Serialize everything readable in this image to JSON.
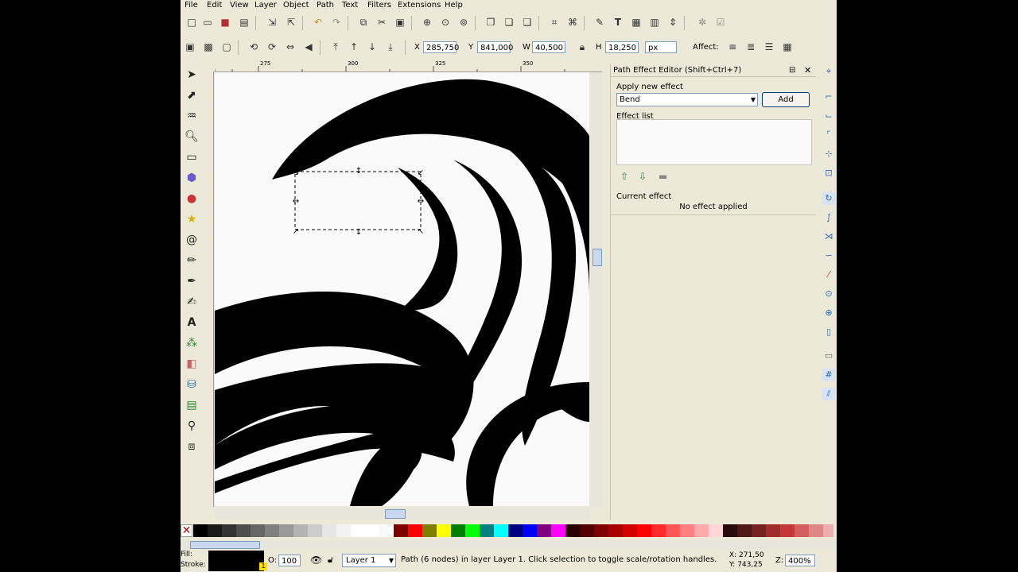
{
  "menu": [
    "File",
    "Edit",
    "View",
    "Layer",
    "Object",
    "Path",
    "Text",
    "Filters",
    "Extensions",
    "Help"
  ],
  "toolcontrols": {
    "x_label": "X",
    "x_value": "285,750",
    "y_label": "Y",
    "y_value": "841,000",
    "w_label": "W",
    "w_value": "40,500",
    "h_label": "H",
    "h_value": "18,250",
    "unit": "px",
    "affect_label": "Affect:"
  },
  "ruler": {
    "top": [
      "275",
      "300",
      "325",
      "350",
      "375"
    ]
  },
  "dock": {
    "title": "Path Effect Editor (Shift+Ctrl+7)",
    "apply_label": "Apply new effect",
    "effect_selected": "Bend",
    "add_label": "Add",
    "list_label": "Effect list",
    "current_label": "Current effect",
    "current_value": "No effect applied"
  },
  "status": {
    "fill_label": "Fill:",
    "stroke_label": "Stroke:",
    "opacity_label": "O:",
    "opacity_value": "100",
    "layer": "Layer 1",
    "message": "Path (6 nodes) in layer Layer 1. Click selection to toggle scale/rotation handles.",
    "cursor_x": "X: 271,50",
    "cursor_y": "Y: 743,25",
    "zoom_label": "Z:",
    "zoom_value": "400%"
  },
  "colors": {
    "accent": "#2a6ebb",
    "panel": "#ece9d8",
    "canvas": "#fafafa"
  }
}
